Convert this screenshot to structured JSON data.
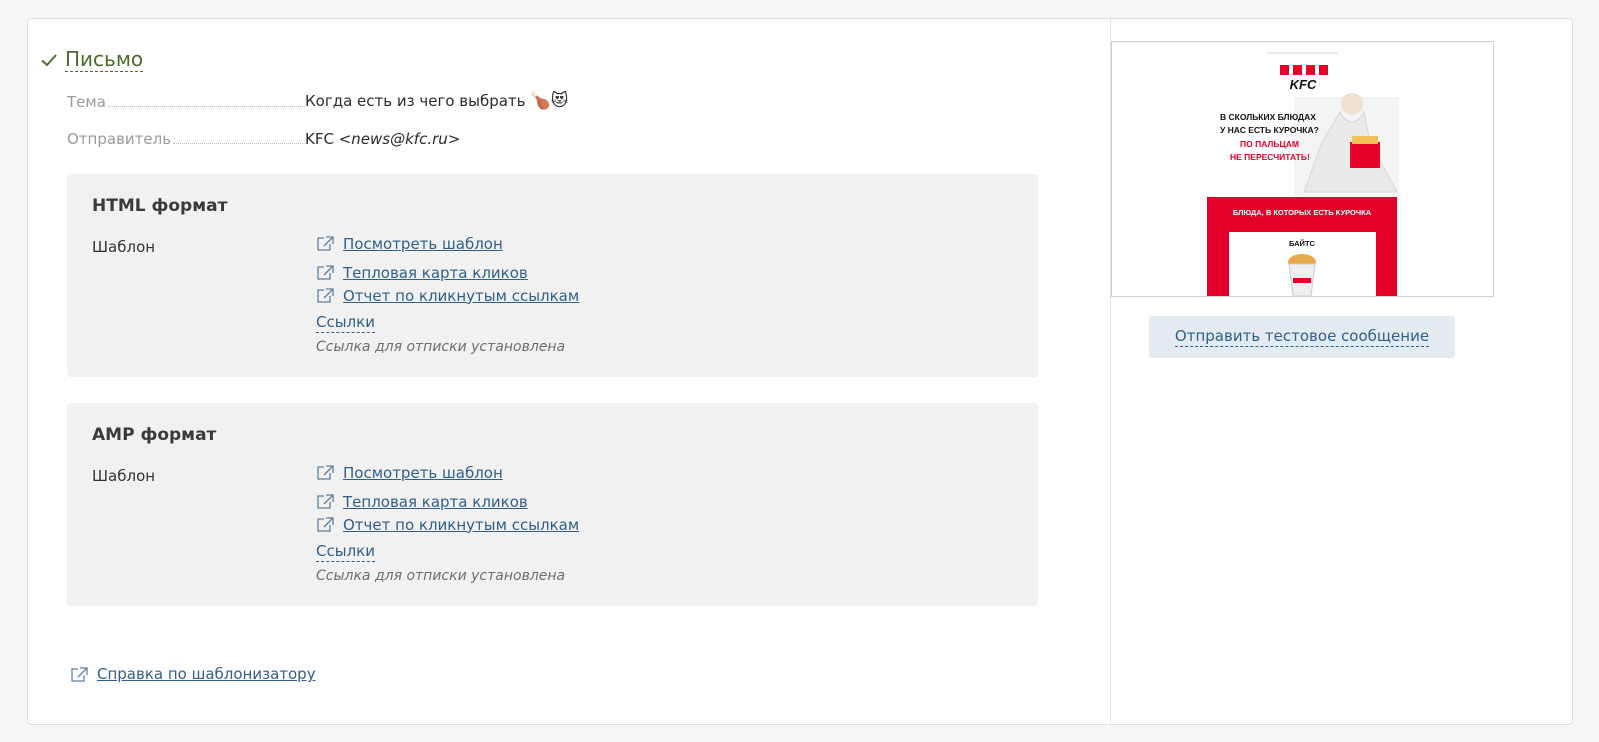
{
  "section": {
    "title": "Письмо"
  },
  "fields": {
    "subject_label": "Тема",
    "subject_value": "Когда есть из чего выбрать",
    "subject_emoji": "🍗😻",
    "sender_label": "Отправитель",
    "sender_name": "KFC",
    "sender_email": "<news@kfc.ru>"
  },
  "html_format": {
    "title": "HTML формат",
    "template_label": "Шаблон",
    "links": [
      "Посмотреть шаблон",
      "Тепловая карта кликов",
      "Отчет по кликнутым ссылкам"
    ],
    "links_toggle": "Ссылки",
    "unsubscribe_note": "Ссылка для отписки установлена"
  },
  "amp_format": {
    "title": "AMP формат",
    "template_label": "Шаблон",
    "links": [
      "Посмотреть шаблон",
      "Тепловая карта кликов",
      "Отчет по кликнутым ссылкам"
    ],
    "links_toggle": "Ссылки",
    "unsubscribe_note": "Ссылка для отписки установлена"
  },
  "help_link": "Справка по шаблонизатору",
  "preview": {
    "brand": "KFC",
    "headline_1": "В СКОЛЬКИХ БЛЮДАХ",
    "headline_2": "У НАС ЕСТЬ КУРОЧКА?",
    "headline_3": "ПО ПАЛЬЦАМ",
    "headline_4": "НЕ ПЕРЕСЧИТАТЬ!",
    "banner": "БЛЮДА, В КОТОРЫХ ЕСТЬ КУРОЧКА",
    "item": "БАЙТС"
  },
  "send_test_button": "Отправить тестовое сообщение",
  "colors": {
    "link": "#2f5f8a",
    "section_title": "#4e6a2a",
    "kfc_red": "#e4002b"
  }
}
